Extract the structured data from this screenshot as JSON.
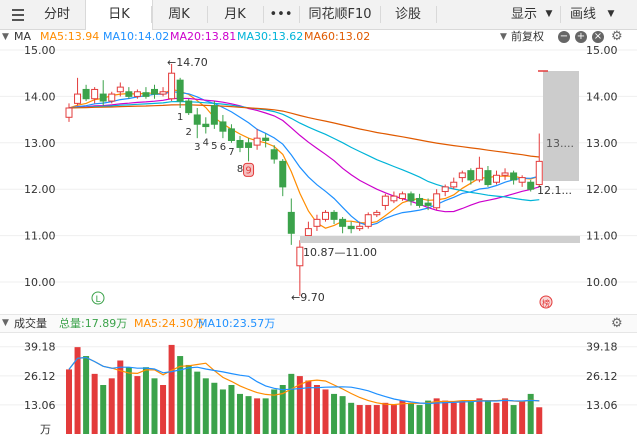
{
  "toolbar": {
    "tabs": [
      "分时",
      "日K",
      "周K",
      "月K",
      "•••",
      "同花顺F10",
      "诊股"
    ],
    "active_tab": "日K",
    "display_label": "显示",
    "draw_label": "画线"
  },
  "ma_bar": {
    "title": "MA",
    "items": [
      {
        "label": "MA5:13.94",
        "color": "#ff8c00"
      },
      {
        "label": "MA10:14.02",
        "color": "#1e90ff"
      },
      {
        "label": "MA20:13.81",
        "color": "#cc00cc"
      },
      {
        "label": "MA30:13.62",
        "color": "#00b4d8"
      },
      {
        "label": "MA60:13.02",
        "color": "#e05a00"
      }
    ],
    "adjust_label": "前复权"
  },
  "price_axis": {
    "ticks": [
      "15.00",
      "14.00",
      "13.00",
      "12.00",
      "11.00",
      "10.00"
    ]
  },
  "annotations": {
    "high": "←14.70",
    "low": "←9.70",
    "gap": "10.87—11.00",
    "range_top": "13....",
    "range_bottom": "12.1...",
    "td_counts": [
      "1",
      "2",
      "3",
      "4",
      "5",
      "6",
      "7",
      "8",
      "9"
    ],
    "l_marker": "L",
    "rank_marker": "榜"
  },
  "volume_bar": {
    "title": "成交量",
    "total": "总量:17.89万",
    "ma5": "MA5:24.30万",
    "ma10": "MA10:23.57万",
    "ticks": [
      "39.18",
      "26.12",
      "13.06"
    ],
    "unit": "万"
  },
  "colors": {
    "up": "#e33b3b",
    "down": "#3ba24a",
    "ma5": "#ff8c00",
    "ma10": "#1e90ff",
    "ma20": "#cc00cc",
    "ma30": "#00b4d8",
    "ma60": "#e05a00"
  },
  "candles": [
    {
      "o": 13.55,
      "c": 13.75,
      "h": 13.85,
      "l": 13.45
    },
    {
      "o": 13.85,
      "c": 14.05,
      "h": 14.4,
      "l": 13.8
    },
    {
      "o": 14.15,
      "c": 13.95,
      "h": 14.25,
      "l": 13.9
    },
    {
      "o": 13.95,
      "c": 14.15,
      "h": 14.2,
      "l": 13.85
    },
    {
      "o": 14.05,
      "c": 13.9,
      "h": 14.35,
      "l": 13.8
    },
    {
      "o": 13.9,
      "c": 14.05,
      "h": 14.1,
      "l": 13.85
    },
    {
      "o": 14.1,
      "c": 14.2,
      "h": 14.3,
      "l": 14.0
    },
    {
      "o": 14.1,
      "c": 14.0,
      "h": 14.2,
      "l": 13.95
    },
    {
      "o": 14.0,
      "c": 14.1,
      "h": 14.15,
      "l": 13.95
    },
    {
      "o": 14.08,
      "c": 14.0,
      "h": 14.2,
      "l": 13.95
    },
    {
      "o": 14.15,
      "c": 14.05,
      "h": 14.25,
      "l": 13.95
    },
    {
      "o": 14.05,
      "c": 14.1,
      "h": 14.2,
      "l": 14.0
    },
    {
      "o": 13.95,
      "c": 14.5,
      "h": 14.7,
      "l": 13.9
    },
    {
      "o": 14.35,
      "c": 13.9,
      "h": 14.4,
      "l": 13.75
    },
    {
      "o": 13.9,
      "c": 13.65,
      "h": 13.95,
      "l": 13.6
    },
    {
      "o": 13.6,
      "c": 13.4,
      "h": 13.75,
      "l": 13.1
    },
    {
      "o": 13.4,
      "c": 13.35,
      "h": 13.55,
      "l": 13.2
    },
    {
      "o": 13.8,
      "c": 13.4,
      "h": 13.9,
      "l": 13.3
    },
    {
      "o": 13.45,
      "c": 13.25,
      "h": 13.6,
      "l": 13.1
    },
    {
      "o": 13.3,
      "c": 13.05,
      "h": 13.4,
      "l": 13.0
    },
    {
      "o": 13.05,
      "c": 12.9,
      "h": 13.15,
      "l": 12.8
    },
    {
      "o": 13.0,
      "c": 12.9,
      "h": 13.1,
      "l": 12.6
    },
    {
      "o": 12.95,
      "c": 13.1,
      "h": 13.3,
      "l": 12.85
    },
    {
      "o": 13.1,
      "c": 13.05,
      "h": 13.2,
      "l": 12.9
    },
    {
      "o": 12.85,
      "c": 12.65,
      "h": 12.95,
      "l": 12.55
    },
    {
      "o": 12.6,
      "c": 12.05,
      "h": 12.65,
      "l": 11.85
    },
    {
      "o": 11.5,
      "c": 11.05,
      "h": 11.8,
      "l": 10.8
    },
    {
      "o": 10.35,
      "c": 10.75,
      "h": 10.9,
      "l": 9.7
    },
    {
      "o": 11.0,
      "c": 11.15,
      "h": 11.3,
      "l": 10.95
    },
    {
      "o": 11.2,
      "c": 11.35,
      "h": 11.45,
      "l": 11.1
    },
    {
      "o": 11.35,
      "c": 11.5,
      "h": 11.55,
      "l": 11.3
    },
    {
      "o": 11.5,
      "c": 11.35,
      "h": 11.55,
      "l": 11.25
    },
    {
      "o": 11.35,
      "c": 11.2,
      "h": 11.4,
      "l": 11.05
    },
    {
      "o": 11.2,
      "c": 11.15,
      "h": 11.3,
      "l": 11.05
    },
    {
      "o": 11.15,
      "c": 11.2,
      "h": 11.3,
      "l": 11.1
    },
    {
      "o": 11.2,
      "c": 11.45,
      "h": 11.5,
      "l": 11.15
    },
    {
      "o": 11.45,
      "c": 11.5,
      "h": 11.55,
      "l": 11.4
    },
    {
      "o": 11.65,
      "c": 11.85,
      "h": 11.9,
      "l": 11.55
    },
    {
      "o": 11.75,
      "c": 11.85,
      "h": 11.95,
      "l": 11.7
    },
    {
      "o": 11.8,
      "c": 11.9,
      "h": 11.95,
      "l": 11.75
    },
    {
      "o": 11.9,
      "c": 11.75,
      "h": 11.95,
      "l": 11.65
    },
    {
      "o": 11.8,
      "c": 11.65,
      "h": 11.9,
      "l": 11.6
    },
    {
      "o": 11.7,
      "c": 11.65,
      "h": 11.8,
      "l": 11.55
    },
    {
      "o": 11.6,
      "c": 11.9,
      "h": 12.0,
      "l": 11.55
    },
    {
      "o": 11.95,
      "c": 12.05,
      "h": 12.1,
      "l": 11.85
    },
    {
      "o": 12.05,
      "c": 12.15,
      "h": 12.25,
      "l": 12.0
    },
    {
      "o": 12.25,
      "c": 12.35,
      "h": 12.4,
      "l": 12.15
    },
    {
      "o": 12.4,
      "c": 12.2,
      "h": 12.45,
      "l": 12.1
    },
    {
      "o": 12.2,
      "c": 12.45,
      "h": 12.7,
      "l": 12.15
    },
    {
      "o": 12.4,
      "c": 12.1,
      "h": 12.5,
      "l": 12.05
    },
    {
      "o": 12.15,
      "c": 12.3,
      "h": 12.4,
      "l": 12.1
    },
    {
      "o": 12.3,
      "c": 12.35,
      "h": 12.45,
      "l": 12.2
    },
    {
      "o": 12.35,
      "c": 12.2,
      "h": 12.4,
      "l": 12.1
    },
    {
      "o": 12.15,
      "c": 12.25,
      "h": 12.3,
      "l": 12.05
    },
    {
      "o": 12.15,
      "c": 12.0,
      "h": 12.2,
      "l": 11.95
    },
    {
      "o": 12.1,
      "c": 12.6,
      "h": 13.2,
      "l": 12.05
    }
  ],
  "volumes": [
    29,
    39,
    35,
    27,
    22,
    25,
    33,
    30,
    26,
    30,
    25,
    22,
    40,
    35,
    31,
    28,
    25,
    23,
    20,
    22,
    18,
    17,
    16,
    16,
    20,
    22,
    27,
    26,
    24,
    22,
    20,
    18,
    17,
    14,
    13,
    13,
    13,
    14,
    13,
    15,
    14,
    13,
    15,
    16,
    15,
    14,
    15,
    15,
    16,
    15,
    14,
    16,
    13,
    15,
    18,
    12
  ]
}
